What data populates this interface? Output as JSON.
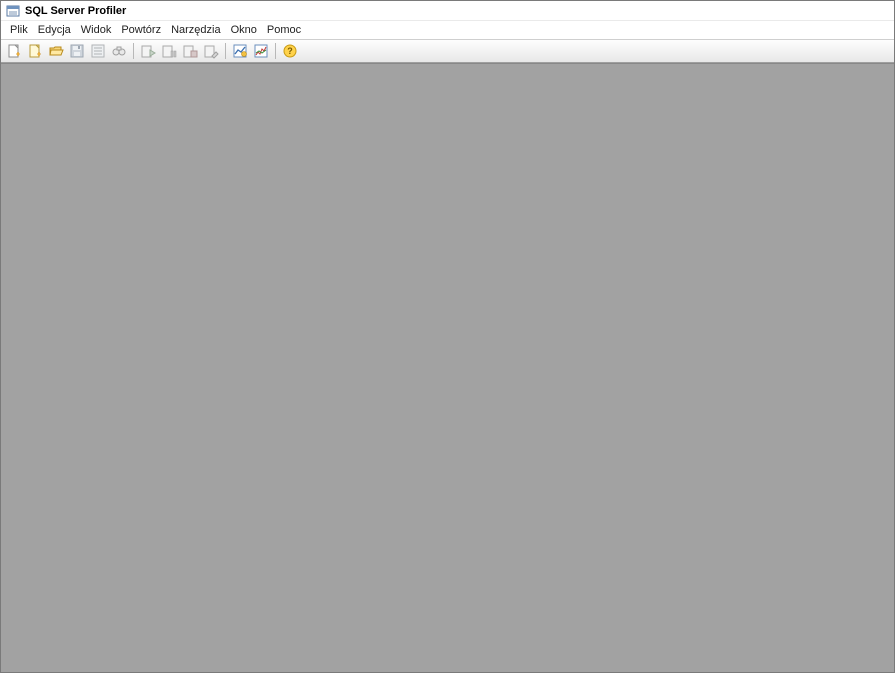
{
  "titlebar": {
    "title": "SQL Server Profiler"
  },
  "menu": {
    "file": "Plik",
    "edit": "Edycja",
    "view": "Widok",
    "replay": "Powtórz",
    "tools": "Narzędzia",
    "window": "Okno",
    "help": "Pomoc"
  },
  "toolbar": {
    "new_trace": "new-trace",
    "new_template": "new-template",
    "open": "open",
    "save": "save",
    "properties": "properties",
    "find": "find",
    "run": "run",
    "pause": "pause",
    "stop": "stop",
    "clear": "clear",
    "tuning": "tuning",
    "activity": "activity",
    "help": "help"
  }
}
